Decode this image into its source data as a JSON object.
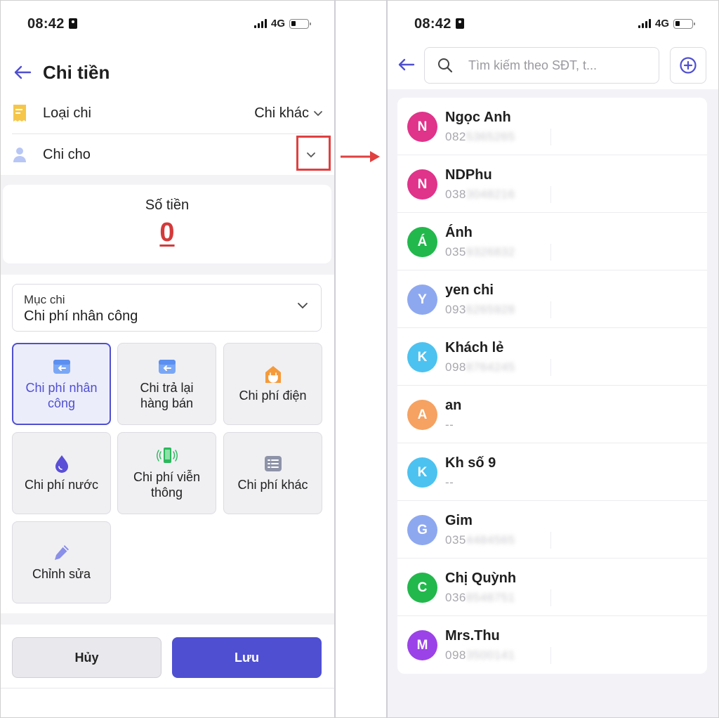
{
  "left": {
    "status": {
      "time": "08:42",
      "network": "4G"
    },
    "header": {
      "title": "Chi tiền"
    },
    "type_row": {
      "label": "Loại chi",
      "value": "Chi khác"
    },
    "recipient_row": {
      "label": "Chi cho"
    },
    "amount": {
      "caption": "Số tiền",
      "value": "0"
    },
    "category": {
      "label": "Mục chi",
      "value": "Chi phí nhân công"
    },
    "tiles": [
      {
        "label": "Chi phí nhân công",
        "icon": "return-box-icon",
        "active": true
      },
      {
        "label": "Chi trả lại hàng bán",
        "icon": "return-box-icon",
        "active": false
      },
      {
        "label": "Chi phí điện",
        "icon": "electric-plug-icon",
        "active": false
      },
      {
        "label": "Chi phí nước",
        "icon": "water-drop-icon",
        "active": false
      },
      {
        "label": "Chi phí viễn thông",
        "icon": "phone-icon",
        "active": false
      },
      {
        "label": "Chi phí khác",
        "icon": "list-icon",
        "active": false
      },
      {
        "label": "Chỉnh sửa",
        "icon": "pencil-icon",
        "active": false
      }
    ],
    "buttons": {
      "cancel": "Hủy",
      "save": "Lưu"
    }
  },
  "right": {
    "status": {
      "time": "08:42",
      "network": "4G"
    },
    "search": {
      "placeholder": "Tìm kiếm theo SĐT, t..."
    },
    "contacts": [
      {
        "initial": "N",
        "name": "Ngọc Anh",
        "phone_prefix": "082",
        "phone_rest": "5365265",
        "color": "#e0338a"
      },
      {
        "initial": "N",
        "name": "NDPhu",
        "phone_prefix": "038",
        "phone_rest": "3048216",
        "color": "#e0338a"
      },
      {
        "initial": "Á",
        "name": "Ánh",
        "phone_prefix": "035",
        "phone_rest": "9326832",
        "color": "#22b84c"
      },
      {
        "initial": "Y",
        "name": "yen chi",
        "phone_prefix": "093",
        "phone_rest": "6265928",
        "color": "#8ea8f0"
      },
      {
        "initial": "K",
        "name": "Khách lẻ",
        "phone_prefix": "098",
        "phone_rest": "8764245",
        "color": "#4cc2f0"
      },
      {
        "initial": "A",
        "name": "an",
        "phone_prefix": "--",
        "phone_rest": "",
        "color": "#f5a262"
      },
      {
        "initial": "K",
        "name": "Kh số 9",
        "phone_prefix": "--",
        "phone_rest": "",
        "color": "#4cc2f0"
      },
      {
        "initial": "G",
        "name": "Gim",
        "phone_prefix": "035",
        "phone_rest": "4484565",
        "color": "#8ea8f0"
      },
      {
        "initial": "C",
        "name": "Chị Quỳnh",
        "phone_prefix": "036",
        "phone_rest": "8548751",
        "color": "#22b84c"
      },
      {
        "initial": "M",
        "name": "Mrs.Thu",
        "phone_prefix": "098",
        "phone_rest": "3500141",
        "color": "#9b42e8"
      }
    ]
  },
  "colors": {
    "accent": "#4f4fd1",
    "amount": "#d43a3a",
    "highlight": "#e04040"
  }
}
